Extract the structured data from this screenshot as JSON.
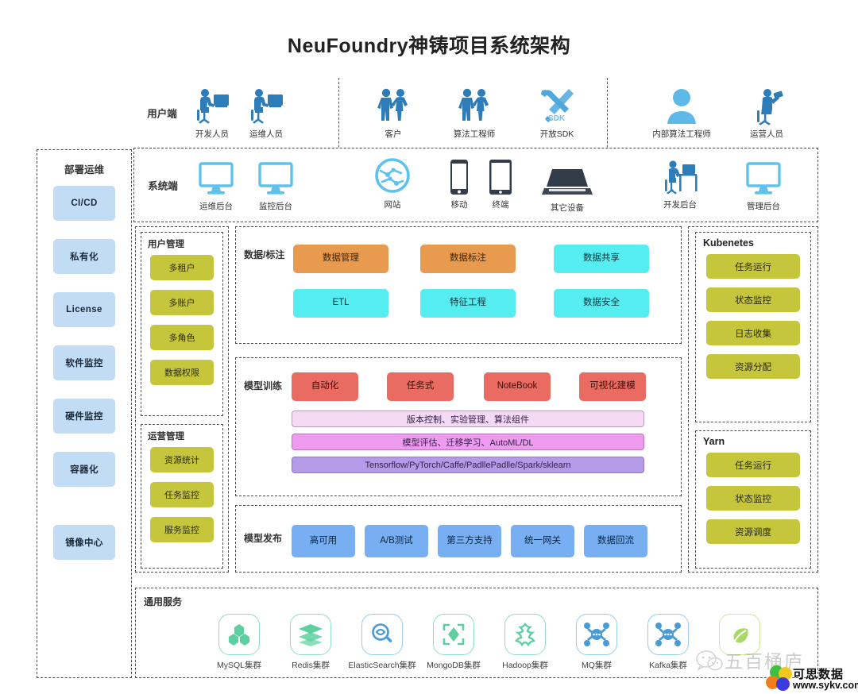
{
  "title": "NeuFoundry神铸项目系统架构",
  "top": {
    "users_label": "用户端",
    "system_label": "系统端",
    "users": [
      {
        "caption": "开发人员",
        "icon": "developer-at-desk-icon"
      },
      {
        "caption": "运维人员",
        "icon": "ops-at-desk-icon"
      },
      {
        "caption": "客户",
        "icon": "customers-icon"
      },
      {
        "caption": "算法工程师",
        "icon": "algorithm-engineers-icon"
      },
      {
        "caption": "开放SDK",
        "icon": "sdk-tools-icon"
      },
      {
        "caption": "内部算法工程师",
        "icon": "person-avatar-icon"
      },
      {
        "caption": "运营人员",
        "icon": "operator-at-desk-icon"
      }
    ],
    "systems": [
      {
        "caption": "运维后台",
        "icon": "monitor-icon"
      },
      {
        "caption": "监控后台",
        "icon": "monitor-icon"
      },
      {
        "caption": "网站",
        "icon": "globe-network-icon"
      },
      {
        "caption": "移动",
        "icon": "mobile-phone-icon"
      },
      {
        "caption": "终端",
        "icon": "tablet-icon"
      },
      {
        "caption": "其它设备",
        "icon": "laptop-device-icon"
      },
      {
        "caption": "开发后台",
        "icon": "developer-desk-icon"
      },
      {
        "caption": "管理后台",
        "icon": "monitor-icon"
      }
    ]
  },
  "deploy_ops": {
    "title": "部署运维",
    "items": [
      "CI/CD",
      "私有化",
      "License",
      "软件监控",
      "硬件监控",
      "容器化",
      "镜像中心"
    ]
  },
  "user_management": {
    "title": "用户管理",
    "items": [
      "多租户",
      "多账户",
      "多角色",
      "数据权限"
    ]
  },
  "operation_management": {
    "title": "运营管理",
    "items": [
      "资源统计",
      "任务监控",
      "服务监控"
    ]
  },
  "data_annotation": {
    "title": "数据/标注",
    "row1": [
      "数据管理",
      "数据标注",
      "数据共享"
    ],
    "row2": [
      "ETL",
      "特征工程",
      "数据安全"
    ]
  },
  "model_training": {
    "title": "模型训练",
    "chips": [
      "自动化",
      "任务式",
      "NoteBook",
      "可视化建模"
    ],
    "bars": [
      "版本控制、实验管理、算法组件",
      "模型评估、迁移学习、AutoML/DL",
      "Tensorflow/PyTorch/Caffe/PadllePadlle/Spark/sklearn"
    ]
  },
  "model_release": {
    "title": "模型发布",
    "chips": [
      "高可用",
      "A/B测试",
      "第三方支持",
      "统一网关",
      "数据回流"
    ]
  },
  "kubernetes": {
    "title": "Kubenetes",
    "items": [
      "任务运行",
      "状态监控",
      "日志收集",
      "资源分配"
    ]
  },
  "yarn": {
    "title": "Yarn",
    "items": [
      "任务运行",
      "状态监控",
      "资源调度"
    ]
  },
  "common_services": {
    "title": "通用服务",
    "items": [
      {
        "caption": "MySQL集群",
        "icon": "mysql-cluster-icon",
        "color": "#5ECFA0"
      },
      {
        "caption": "Redis集群",
        "icon": "redis-stack-icon",
        "color": "#5ECFA0"
      },
      {
        "caption": "ElasticSearch集群",
        "icon": "elasticsearch-icon",
        "color": "#4A9AD4"
      },
      {
        "caption": "MongoDB集群",
        "icon": "mongodb-icon",
        "color": "#5ECFA0"
      },
      {
        "caption": "Hadoop集群",
        "icon": "hadoop-icon",
        "color": "#5ECFA0"
      },
      {
        "caption": "MQ集群",
        "icon": "mq-node-icon",
        "color": "#4A9AD4"
      },
      {
        "caption": "Kafka集群",
        "icon": "kafka-node-icon",
        "color": "#4A9AD4"
      },
      {
        "caption": "",
        "icon": "leaf-cloud-icon",
        "color": "#A8D86A"
      }
    ]
  },
  "watermarks": {
    "wechat_text": "五百桶庐",
    "sykv_title": "可思数据",
    "sykv_url": "www.sykv.com"
  },
  "colors": {
    "blue_chip": "#C3DCF5",
    "olive_chip": "#C6C63C",
    "orange_chip": "#E89A4F",
    "cyan_chip": "#55EDEF",
    "red_chip": "#E96B61",
    "blue_box": "#77AFF2",
    "bar_light": "#F5D9F5",
    "bar_mid": "#EE9BEE",
    "bar_deep": "#B49BE8",
    "icon_blue": "#2E7CB8",
    "icon_light_blue": "#5EC2EE"
  }
}
